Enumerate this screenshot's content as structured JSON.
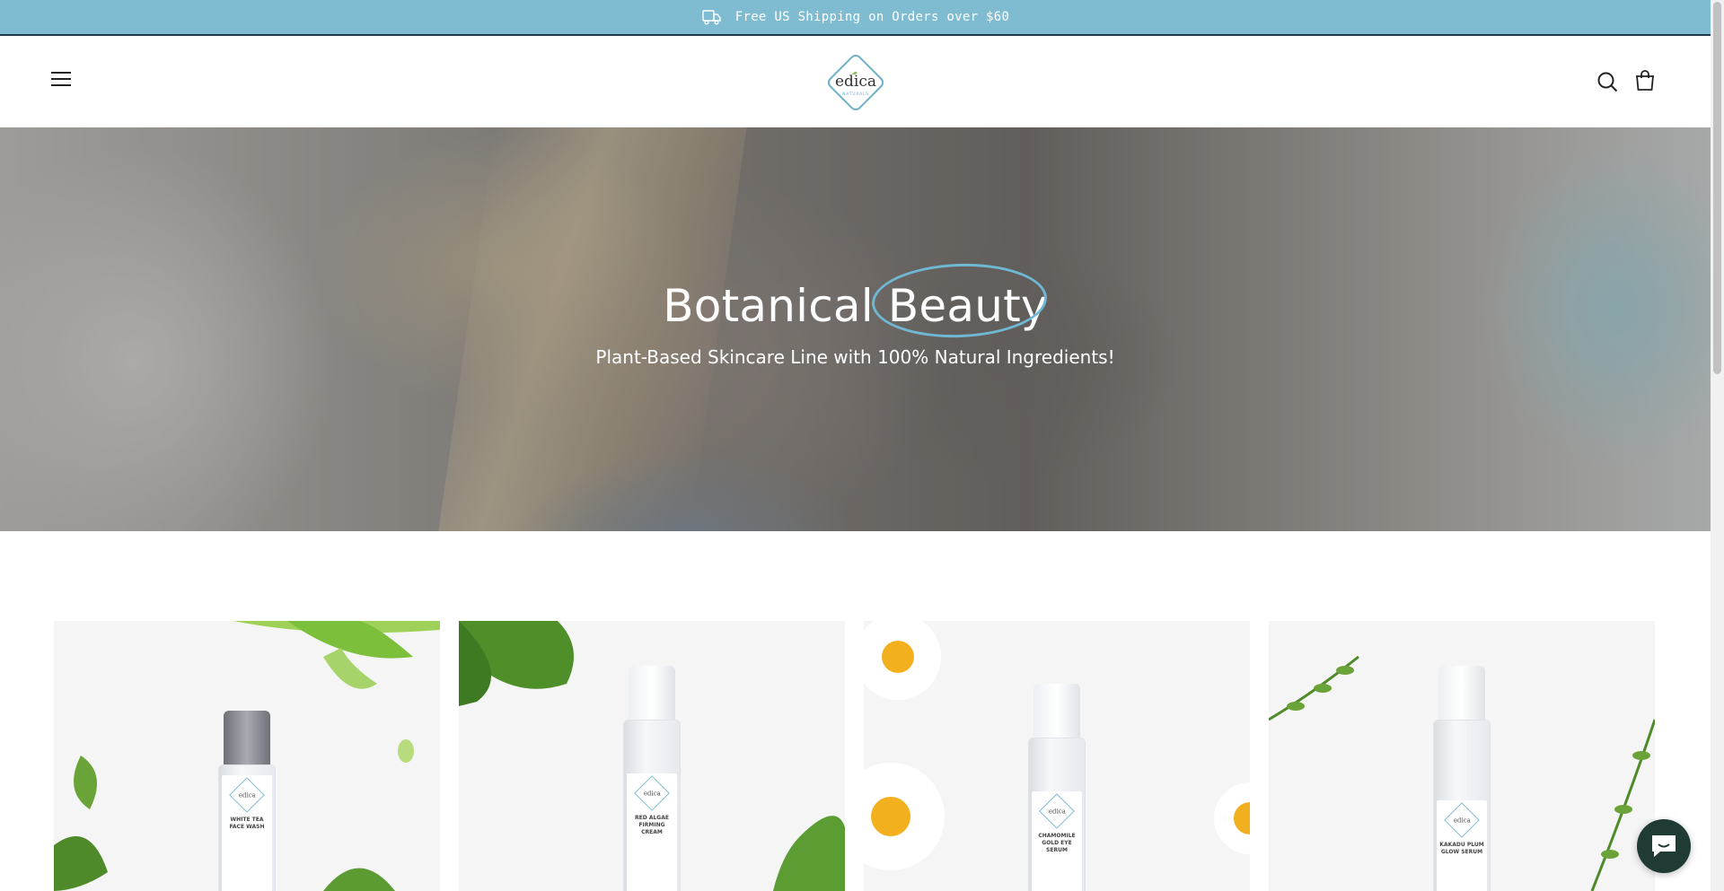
{
  "announcement": {
    "text": "Free US Shipping on Orders over $60",
    "icon": "truck-icon"
  },
  "header": {
    "logo_text": "edica",
    "logo_subtext": "NATURALS",
    "menu_icon": "hamburger-menu-icon",
    "search_icon": "search-icon",
    "cart_icon": "shopping-bag-icon"
  },
  "hero": {
    "title_word1": "Botanical",
    "title_word2": "Beauty",
    "subtitle": "Plant-Based Skincare Line with 100% Natural Ingredients!"
  },
  "products": [
    {
      "name": "WHITE TEA FACE WASH",
      "decor": "aloe-and-leaves"
    },
    {
      "name": "RED ALGAE FIRMING CREAM",
      "decor": "tea-leaves"
    },
    {
      "name": "CHAMOMILE GOLD EYE SERUM",
      "decor": "daisies"
    },
    {
      "name": "KAKADU PLUM GLOW SERUM",
      "decor": "herb-sprigs"
    }
  ],
  "colors": {
    "announcement_bg": "#7fbcd2",
    "accent_circle": "#6fb7d2",
    "chat_bg": "#1f3b34"
  },
  "chat": {
    "icon": "chat-bubble-icon"
  }
}
